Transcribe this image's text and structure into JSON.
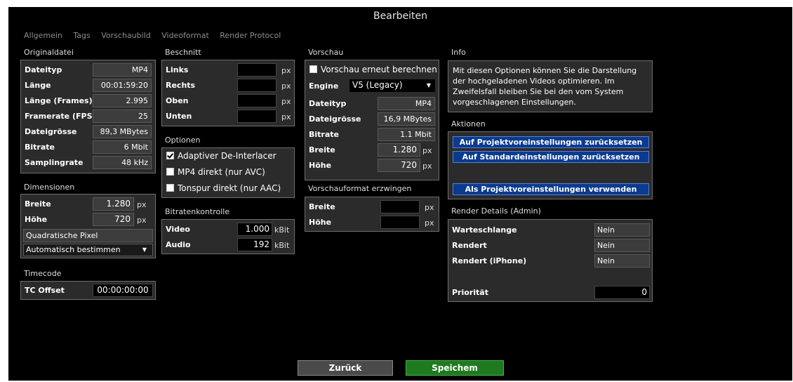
{
  "title": "Bearbeiten",
  "tabs": [
    "Allgemein",
    "Tags",
    "Vorschaubild",
    "Videoformat",
    "Render Protocol"
  ],
  "original": {
    "heading": "Originaldatei",
    "rows": [
      {
        "label": "Dateityp",
        "value": "MP4"
      },
      {
        "label": "Länge",
        "value": "00:01:59:20"
      },
      {
        "label": "Länge (Frames)",
        "value": "2.995"
      },
      {
        "label": "Framerate (FPS)",
        "value": "25"
      },
      {
        "label": "Dateigrösse",
        "value": "89,3 MBytes"
      },
      {
        "label": "Bitrate",
        "value": "6 Mbit"
      },
      {
        "label": "Samplingrate",
        "value": "48 kHz"
      }
    ]
  },
  "dimensions": {
    "heading": "Dimensionen",
    "width_label": "Breite",
    "width_value": "1.280",
    "width_unit": "px",
    "height_label": "Höhe",
    "height_value": "720",
    "height_unit": "px",
    "pixel_label": "Quadratische Pixel",
    "select_value": "Automatisch bestimmen"
  },
  "timecode": {
    "heading": "Timecode",
    "label": "TC Offset",
    "value": "00:00:00:00"
  },
  "crop": {
    "heading": "Beschnitt",
    "rows": [
      {
        "label": "Links",
        "unit": "px"
      },
      {
        "label": "Rechts",
        "unit": "px"
      },
      {
        "label": "Oben",
        "unit": "px"
      },
      {
        "label": "Unten",
        "unit": "px"
      }
    ]
  },
  "options": {
    "heading": "Optionen",
    "items": [
      {
        "label": "Adaptiver De-Interlacer",
        "checked": true
      },
      {
        "label": "MP4 direkt (nur AVC)",
        "checked": false
      },
      {
        "label": "Tonspur direkt (nur AAC)",
        "checked": false
      }
    ]
  },
  "bitrate": {
    "heading": "Bitratenkontrolle",
    "video_label": "Video",
    "video_value": "1.000",
    "video_unit": "kBit",
    "audio_label": "Audio",
    "audio_value": "192",
    "audio_unit": "kBit"
  },
  "preview": {
    "heading": "Vorschau",
    "recalc_label": "Vorschau erneut berechnen",
    "engine_label": "Engine",
    "engine_value": "V5 (Legacy)",
    "rows": [
      {
        "label": "Dateityp",
        "value": "MP4",
        "unit": ""
      },
      {
        "label": "Dateigrösse",
        "value": "16,9 MBytes",
        "unit": ""
      },
      {
        "label": "Bitrate",
        "value": "1.1 Mbit",
        "unit": ""
      },
      {
        "label": "Breite",
        "value": "1.280",
        "unit": "px"
      },
      {
        "label": "Höhe",
        "value": "720",
        "unit": "px"
      }
    ]
  },
  "force": {
    "heading": "Vorschauformat erzwingen",
    "width_label": "Breite",
    "width_unit": "px",
    "height_label": "Höhe",
    "height_unit": "px"
  },
  "info": {
    "heading": "Info",
    "text": "Mit diesen Optionen können Sie die Darstellung der hochgeladenen Videos optimieren. Im Zweifelsfall bleiben Sie bei den vom System vorgeschlagenen Einstellungen."
  },
  "actions": {
    "heading": "Aktionen",
    "buttons": [
      "Auf Projektvoreinstellungen zurücksetzen",
      "Auf Standardeinstellungen zurücksetzen",
      "Als Projektvoreinstellungen verwenden"
    ]
  },
  "render": {
    "heading": "Render Details (Admin)",
    "queue_label": "Warteschlange",
    "queue_value": "Nein",
    "renders_label": "Rendert",
    "renders_value": "Nein",
    "iphone_label": "Rendert (iPhone)",
    "iphone_value": "Nein",
    "priority_label": "Priorität",
    "priority_value": "0"
  },
  "footer": {
    "back_label": "Zurück",
    "save_label": "Speichem",
    "back_color": "#4a4a4a",
    "save_color": "#1f7a1f"
  }
}
